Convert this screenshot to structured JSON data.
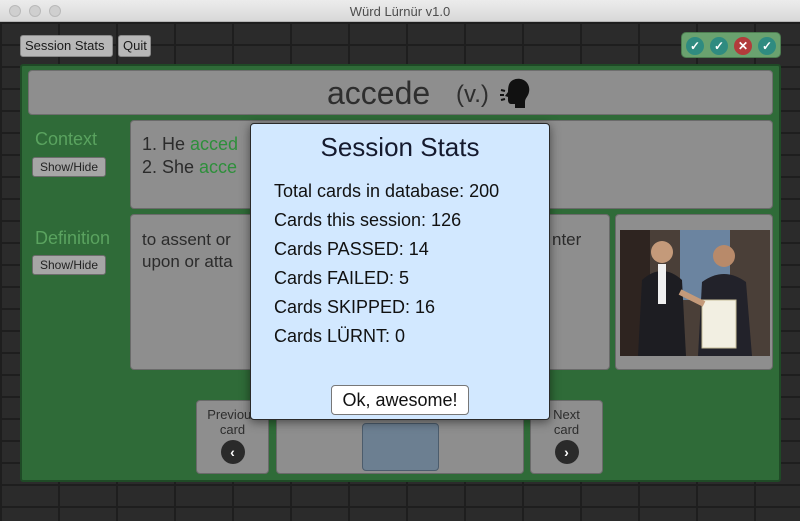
{
  "window": {
    "title": "Würd Lürnür v1.0"
  },
  "toolbar": {
    "session_stats_label": "Session Stats",
    "quit_label": "Quit"
  },
  "status_icons": [
    "check-icon",
    "check-icon",
    "x-icon",
    "check-icon"
  ],
  "card": {
    "word": "accede",
    "part_of_speech": "(v.)",
    "context_label": "Context",
    "definition_label": "Definition",
    "toggle_label": "Show/Hide",
    "context_lines": [
      {
        "prefix": "1. He ",
        "highlight": "acced"
      },
      {
        "prefix": "2. She ",
        "highlight": "acce"
      }
    ],
    "definition_lines": [
      "to assent or",
      "upon or atta",
      "nter"
    ]
  },
  "nav": {
    "prev_label_line1": "Previous",
    "prev_label_line2": "card",
    "next_label_line1": "Next",
    "next_label_line2": "card"
  },
  "modal": {
    "title": "Session Stats",
    "lines": [
      "Total cards in database: 200",
      "Cards this session: 126",
      "Cards PASSED: 14",
      "Cards FAILED: 5",
      "Cards SKIPPED: 16",
      "Cards LÜRNT: 0"
    ],
    "ok_label": "Ok, awesome!"
  },
  "colors": {
    "board_green": "#2f6b38",
    "highlight_green": "#2e8f3b",
    "modal_bg": "#d2e8ff",
    "fail_red": "#b23b3b"
  }
}
